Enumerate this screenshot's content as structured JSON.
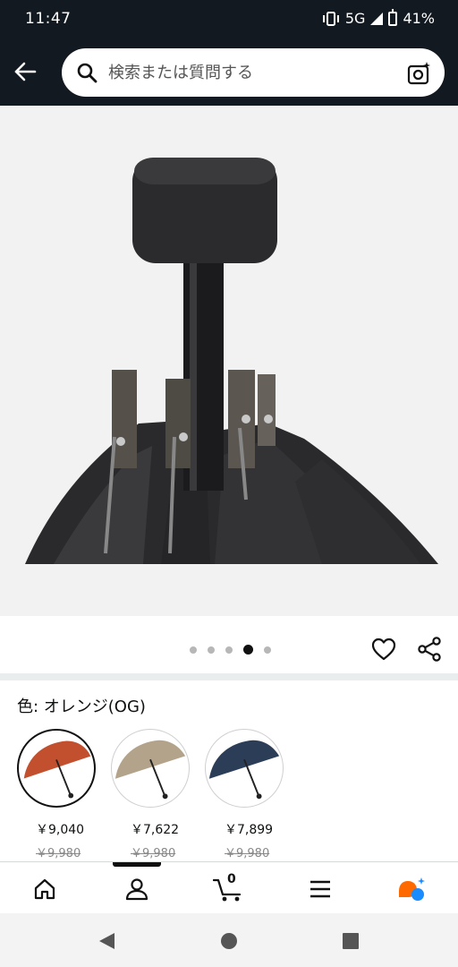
{
  "status_bar": {
    "time": "11:47",
    "network": "5G",
    "battery": "41%"
  },
  "search": {
    "placeholder": "検索または質問する"
  },
  "carousel": {
    "dot_count": 5,
    "active_index": 3
  },
  "product": {
    "color_label": "色: オレンジ(OG)",
    "variants": [
      {
        "price": "￥9,040",
        "list_price": "￥9,980",
        "color": "#c2502f",
        "selected": true
      },
      {
        "price": "￥7,622",
        "list_price": "￥9,980",
        "color": "#b3a38a",
        "selected": false
      },
      {
        "price": "￥7,899",
        "list_price": "￥9,980",
        "color": "#2c3e57",
        "selected": false
      }
    ]
  },
  "bottom_nav": {
    "cart_count": "0",
    "icons": [
      "home-icon",
      "account-icon",
      "cart-icon",
      "menu-icon",
      "rufus-icon"
    ],
    "accent_colors": [
      "#ff6a00",
      "#1a8cff"
    ]
  },
  "colors": {
    "header_bg": "#131921",
    "page_bg": "#ffffff"
  }
}
